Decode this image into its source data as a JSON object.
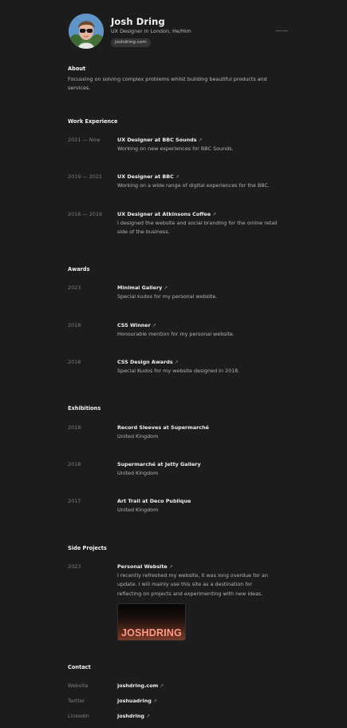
{
  "profile": {
    "name": "Josh Dring",
    "subtitle": "UX Designer in London, He/Him",
    "domain": "joshdring.com",
    "more_icon": "ellipsis-icon"
  },
  "about": {
    "heading": "About",
    "text": "Focussing on solving complex problems whilst building beautiful products and services."
  },
  "work": {
    "heading": "Work Experience",
    "items": [
      {
        "date": "2021 — Now",
        "title": "UX Designer at BBC Sounds",
        "arrow": "↗",
        "desc": "Working on new experiences for BBC Sounds."
      },
      {
        "date": "2019 — 2021",
        "title": "UX Designer at BBC",
        "arrow": "↗",
        "desc": "Working on a wide range of digital experiences for the BBC."
      },
      {
        "date": "2016 — 2019",
        "title": "UX Designer at Atkinsons Coffee",
        "arrow": "↗",
        "desc": "I designed the website and social branding for the online retail side of the business."
      }
    ]
  },
  "awards": {
    "heading": "Awards",
    "items": [
      {
        "date": "2023",
        "title": "Minimal Gallery",
        "arrow": "↗",
        "desc": "Special kudos for my personal website."
      },
      {
        "date": "2018",
        "title": "CSS Winner",
        "arrow": "↗",
        "desc": "Honourable mention for my personal website."
      },
      {
        "date": "2018",
        "title": "CSS Design Awards",
        "arrow": "↗",
        "desc": "Special Kudos for my website designed in 2018."
      }
    ]
  },
  "exhibitions": {
    "heading": "Exhibitions",
    "items": [
      {
        "date": "2018",
        "title": "Record Sleeves at Supermarché",
        "desc": "United Kingdom"
      },
      {
        "date": "2018",
        "title": "Supermarché at Jetty Gallery",
        "desc": "United Kingdom"
      },
      {
        "date": "2017",
        "title": "Art Trail at Deco Publique",
        "desc": "United Kingdom"
      }
    ]
  },
  "side_projects": {
    "heading": "Side Projects",
    "items": [
      {
        "date": "2023",
        "title": "Personal Website",
        "arrow": "↗",
        "desc": "I recently refreshed my website, it was long overdue for an update. I will mainly use this site as a destination for reflecting on projects and experimenting with new ideas.",
        "thumb_text": "JOSHDRING"
      }
    ]
  },
  "contact": {
    "heading": "Contact",
    "items": [
      {
        "label": "Website",
        "value": "joshdring.com",
        "arrow": "↗"
      },
      {
        "label": "Twitter",
        "value": "joshuadring",
        "arrow": "↗"
      },
      {
        "label": "LinkedIn",
        "value": "joshdring",
        "arrow": "↗"
      }
    ]
  },
  "colors": {
    "background": "#1c1c1c",
    "text_primary": "#efefef",
    "text_secondary": "#b3b3b3",
    "text_muted": "#7e7e7e"
  }
}
